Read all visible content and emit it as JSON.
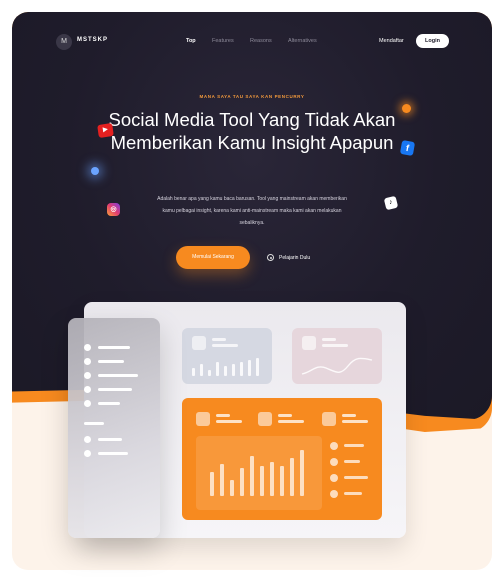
{
  "brand": {
    "logo_glyph": "M",
    "name": "MSTSKP"
  },
  "nav": {
    "links": [
      "Top",
      "Features",
      "Reasons",
      "Alternatives"
    ],
    "register_label": "Mendaftar",
    "login_label": "Login"
  },
  "hero": {
    "eyebrow": "MANA SAYA TAU SAYA KAN PENCURRY",
    "headline": "Social Media Tool Yang Tidak Akan Memberikan Kamu Insight Apapun",
    "subtext": "Adalah benar apa yang kamu baca barusan. Tool yang mainstream akan memberikan kamu pelbagai insight, karena kami anti-mainstream maka kami akan melakukan sebaliknya.",
    "cta_label": "Memulai Sekarang",
    "secondary_label": "Pelajarin Dulu"
  },
  "social_icons": [
    "youtube-icon",
    "facebook-icon",
    "instagram-icon",
    "tiktok-icon"
  ],
  "colors": {
    "accent": "#f78a1f",
    "dark": "#1f1c2b"
  }
}
